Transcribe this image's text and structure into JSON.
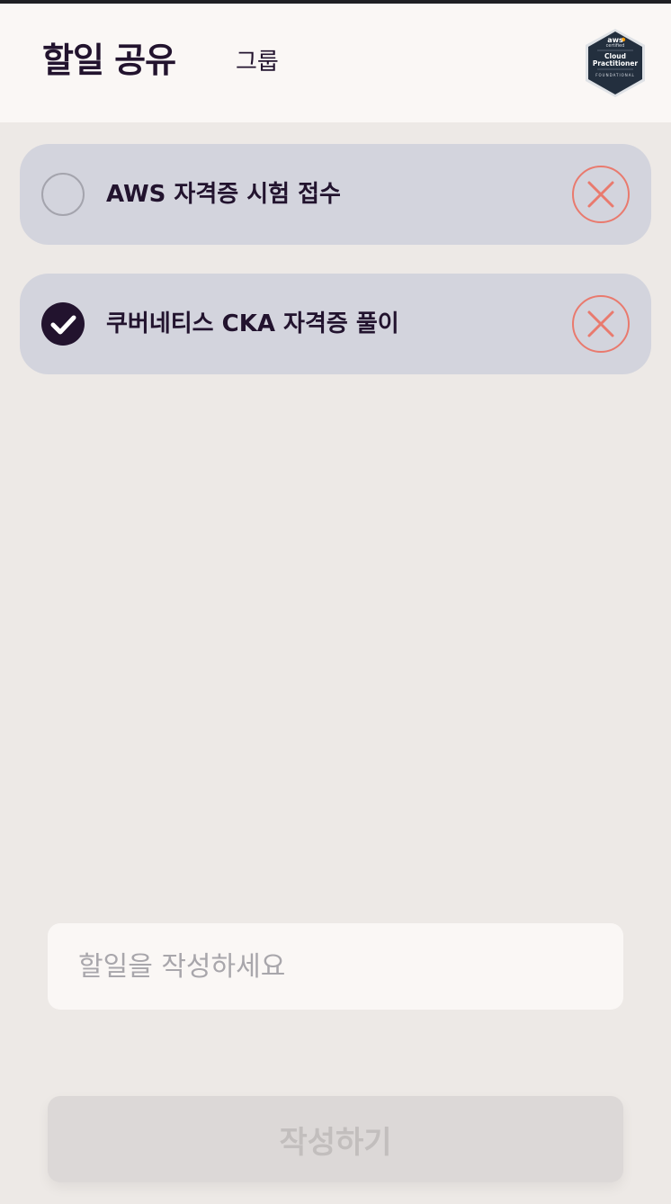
{
  "header": {
    "title": "할일 공유",
    "group_link": "그룹",
    "badge": {
      "icon": "aws-certified-badge-icon",
      "line1": "aws",
      "line2": "certified",
      "line3": "Cloud",
      "line4": "Practitioner",
      "line5": "FOUNDATIONAL"
    }
  },
  "todos": [
    {
      "text": "AWS 자격증 시험 접수",
      "checked": false
    },
    {
      "text": "쿠버네티스 CKA 자격증 풀이",
      "checked": true
    }
  ],
  "composer": {
    "placeholder": "할일을 작성하세요",
    "value": "",
    "submit_label": "작성하기"
  },
  "colors": {
    "ink": "#22132e",
    "item_bg": "#d3d4dd",
    "delete": "#e97a6e",
    "header_bg": "#faf7f5",
    "page_bg": "#ede9e6"
  }
}
